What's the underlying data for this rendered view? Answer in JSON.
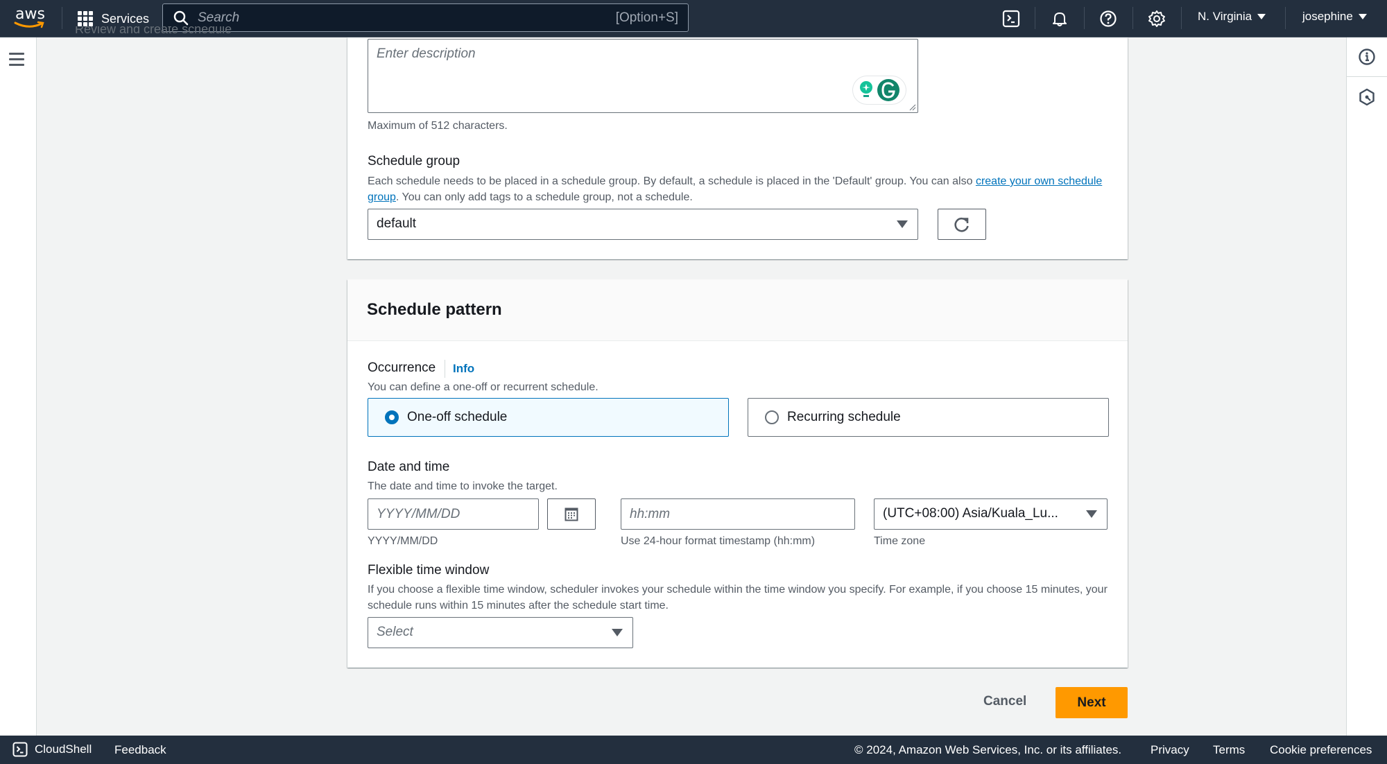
{
  "header": {
    "logo_text": "aws",
    "services_label": "Services",
    "search_placeholder": "Search",
    "search_shortcut": "[Option+S]",
    "region_label": "N. Virginia",
    "user_label": "josephine",
    "icons": [
      "cloudshell-icon",
      "bell-icon",
      "help-icon",
      "settings-icon"
    ]
  },
  "nav": {
    "partial_step_label": "Review and create schedule"
  },
  "description_field": {
    "placeholder": "Enter description",
    "value": "",
    "constraint": "Maximum of 512 characters."
  },
  "schedule_group": {
    "label": "Schedule group",
    "description_before": "Each schedule needs to be placed in a schedule group. By default, a schedule is placed in the 'Default' group. You can also ",
    "link_text": "create your own schedule group",
    "description_after": ". You can only add tags to a schedule group, not a schedule.",
    "selected": "default"
  },
  "schedule_pattern": {
    "title": "Schedule pattern",
    "occurrence": {
      "label": "Occurrence",
      "info_link": "Info",
      "description": "You can define a one-off or recurrent schedule.",
      "options": [
        {
          "label": "One-off schedule",
          "selected": true
        },
        {
          "label": "Recurring schedule",
          "selected": false
        }
      ]
    },
    "date_time": {
      "label": "Date and time",
      "description": "The date and time to invoke the target.",
      "date_placeholder": "YYYY/MM/DD",
      "date_hint": "YYYY/MM/DD",
      "time_placeholder": "hh:mm",
      "time_hint": "Use 24-hour format timestamp (hh:mm)",
      "timezone_value": "(UTC+08:00) Asia/Kuala_Lu...",
      "timezone_hint": "Time zone"
    },
    "flexible_window": {
      "label": "Flexible time window",
      "description": "If you choose a flexible time window, scheduler invokes your schedule within the time window you specify. For example, if you choose 15 minutes, your schedule runs within 15 minutes after the schedule start time.",
      "placeholder": "Select"
    }
  },
  "actions": {
    "cancel_label": "Cancel",
    "next_label": "Next"
  },
  "footer": {
    "cloudshell_label": "CloudShell",
    "feedback_label": "Feedback",
    "copyright": "© 2024, Amazon Web Services, Inc. or its affiliates.",
    "privacy": "Privacy",
    "terms": "Terms",
    "cookies": "Cookie preferences"
  },
  "colors": {
    "header_bg": "#232f3e",
    "accent_blue": "#0073bb",
    "primary_orange": "#ff9900",
    "page_bg": "#f2f3f3"
  }
}
